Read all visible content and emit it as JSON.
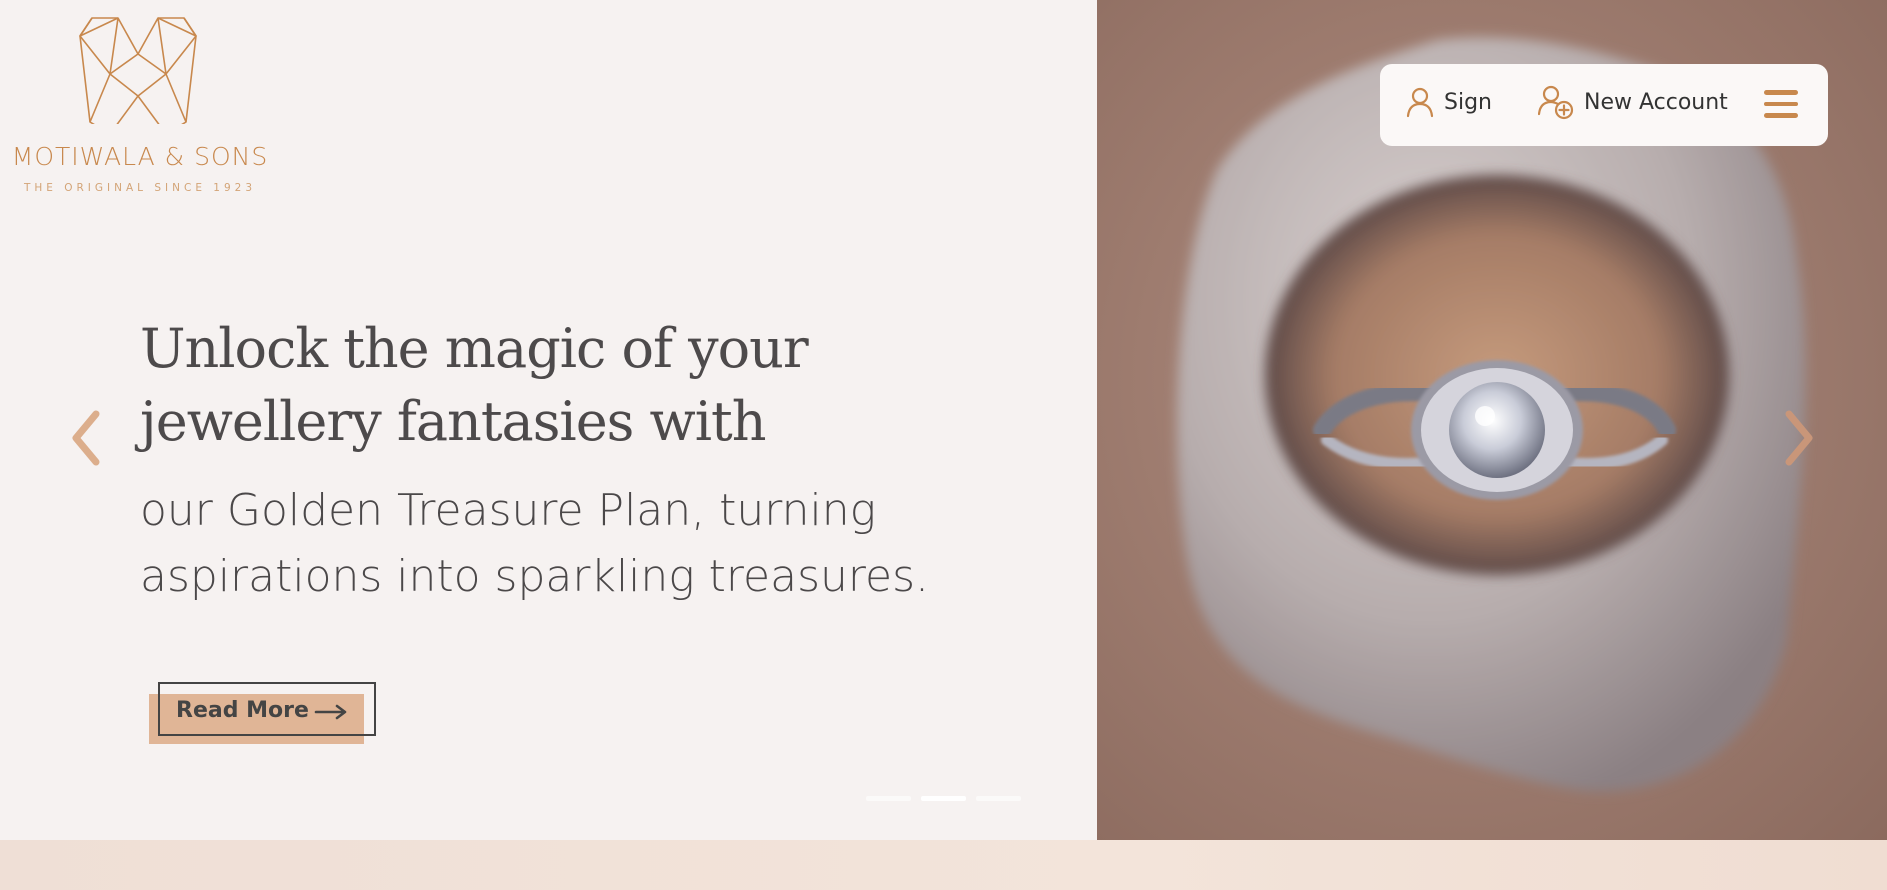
{
  "brand": {
    "name": "MOTIWALA & SONS",
    "tagline": "THE ORIGINAL SINCE 1923",
    "color": "#c8884d"
  },
  "nav": {
    "sign_label": "Sign",
    "new_account_label": "New Account",
    "sign_icon": "user-icon",
    "new_account_icon": "user-plus-icon",
    "menu_icon": "hamburger-menu-icon"
  },
  "hero": {
    "headline_line1": "Unlock the magic of your",
    "headline_line2": "jewellery fantasies with",
    "subline_line1": "our Golden Treasure Plan, turning",
    "subline_line2": "aspirations into sparkling treasures.",
    "cta_label": "Read More",
    "image_subject": "diamond ring on stone"
  },
  "carousel": {
    "slide_count": 3,
    "active_slide": 2,
    "prev_icon": "chevron-left-icon",
    "next_icon": "chevron-right-icon"
  },
  "colors": {
    "accent": "#c8884d",
    "cta_fill": "#e0b596",
    "text_dark": "#4d4a4b",
    "background": "#f6f2f1"
  }
}
